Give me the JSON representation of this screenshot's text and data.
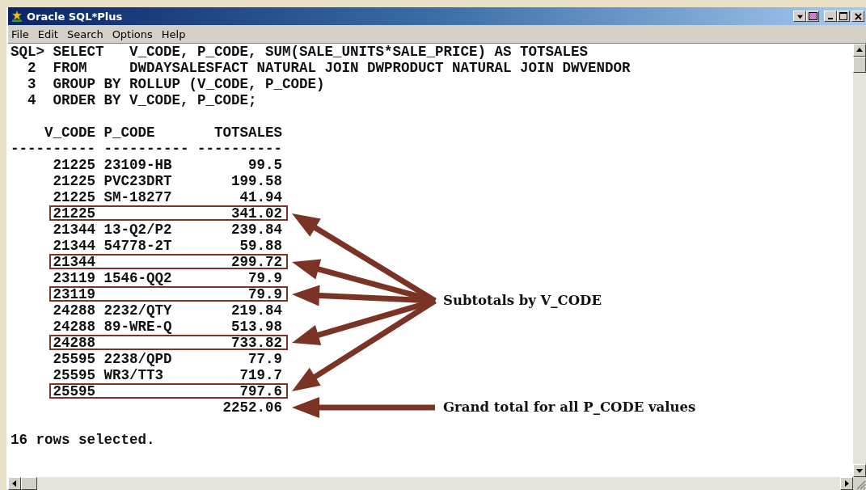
{
  "window": {
    "title": "Oracle SQL*Plus"
  },
  "menu": [
    "File",
    "Edit",
    "Search",
    "Options",
    "Help"
  ],
  "command_lines": [
    "SQL> SELECT   V_CODE, P_CODE, SUM(SALE_UNITS*SALE_PRICE) AS TOTSALES",
    "  2  FROM     DWDAYSALESFACT NATURAL JOIN DWPRODUCT NATURAL JOIN DWVENDOR",
    "  3  GROUP BY ROLLUP (V_CODE, P_CODE)",
    "  4  ORDER BY V_CODE, P_CODE;"
  ],
  "result": {
    "columns": [
      "V_CODE",
      "P_CODE",
      "TOTSALES"
    ],
    "header_rule": "---------- ---------- ----------",
    "rows": [
      {
        "kind": "detail",
        "v_code": "21225",
        "p_code": "23109-HB",
        "totsales": "99.5"
      },
      {
        "kind": "detail",
        "v_code": "21225",
        "p_code": "PVC23DRT",
        "totsales": "199.58"
      },
      {
        "kind": "detail",
        "v_code": "21225",
        "p_code": "SM-18277",
        "totsales": "41.94"
      },
      {
        "kind": "subtotal",
        "v_code": "21225",
        "totsales": "341.02"
      },
      {
        "kind": "detail",
        "v_code": "21344",
        "p_code": "13-Q2/P2",
        "totsales": "239.84"
      },
      {
        "kind": "detail",
        "v_code": "21344",
        "p_code": "54778-2T",
        "totsales": "59.88"
      },
      {
        "kind": "subtotal",
        "v_code": "21344",
        "totsales": "299.72"
      },
      {
        "kind": "detail",
        "v_code": "23119",
        "p_code": "1546-QQ2",
        "totsales": "79.9"
      },
      {
        "kind": "subtotal",
        "v_code": "23119",
        "totsales": "79.9"
      },
      {
        "kind": "detail",
        "v_code": "24288",
        "p_code": "2232/QTY",
        "totsales": "219.84"
      },
      {
        "kind": "detail",
        "v_code": "24288",
        "p_code": "89-WRE-Q",
        "totsales": "513.98"
      },
      {
        "kind": "subtotal",
        "v_code": "24288",
        "totsales": "733.82"
      },
      {
        "kind": "detail",
        "v_code": "25595",
        "p_code": "2238/QPD",
        "totsales": "77.9"
      },
      {
        "kind": "detail",
        "v_code": "25595",
        "p_code": "WR3/TT3",
        "totsales": "719.7"
      },
      {
        "kind": "subtotal",
        "v_code": "25595",
        "totsales": "797.6"
      },
      {
        "kind": "total",
        "totsales": "2252.06"
      }
    ],
    "footer": "16 rows selected."
  },
  "callouts": [
    {
      "label": "Subtotals by V_CODE"
    },
    {
      "label": "Grand total for all P_CODE values"
    }
  ]
}
